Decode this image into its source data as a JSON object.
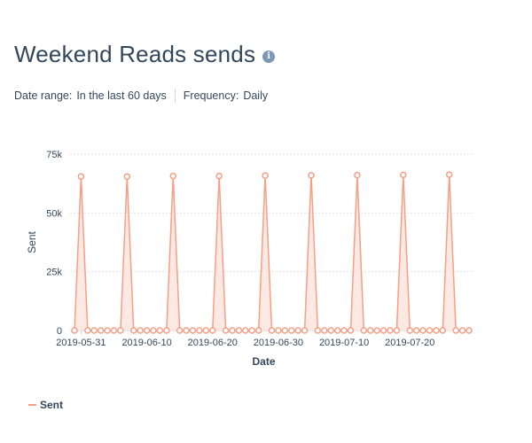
{
  "header": {
    "title": "Weekend Reads sends",
    "info_icon": "info-icon"
  },
  "filters": {
    "date_range_label": "Date range:",
    "date_range_value": "In the last 60 days",
    "frequency_label": "Frequency:",
    "frequency_value": "Daily"
  },
  "colors": {
    "series": "#f59f85",
    "series_fill": "#fde4dc",
    "grid": "#dfe3eb",
    "text": "#33475b"
  },
  "chart_data": {
    "type": "area",
    "title": "",
    "xlabel": "Date",
    "ylabel": "Sent",
    "ylim": [
      0,
      75000
    ],
    "y_ticks": [
      0,
      25000,
      50000,
      75000
    ],
    "y_tick_labels": [
      "0",
      "25k",
      "50k",
      "75k"
    ],
    "x_start": "2019-05-30",
    "x_end": "2019-07-29",
    "x_ticks": [
      "2019-05-31",
      "2019-06-10",
      "2019-06-20",
      "2019-06-30",
      "2019-07-10",
      "2019-07-20"
    ],
    "grid": true,
    "legend": "bottom-left",
    "series": [
      {
        "name": "Sent",
        "points": [
          [
            "2019-05-30",
            0
          ],
          [
            "2019-05-31",
            65500
          ],
          [
            "2019-06-01",
            0
          ],
          [
            "2019-06-02",
            0
          ],
          [
            "2019-06-03",
            0
          ],
          [
            "2019-06-04",
            0
          ],
          [
            "2019-06-05",
            0
          ],
          [
            "2019-06-06",
            0
          ],
          [
            "2019-06-07",
            65500
          ],
          [
            "2019-06-08",
            0
          ],
          [
            "2019-06-09",
            0
          ],
          [
            "2019-06-10",
            0
          ],
          [
            "2019-06-11",
            0
          ],
          [
            "2019-06-12",
            0
          ],
          [
            "2019-06-13",
            0
          ],
          [
            "2019-06-14",
            65700
          ],
          [
            "2019-06-15",
            0
          ],
          [
            "2019-06-16",
            0
          ],
          [
            "2019-06-17",
            0
          ],
          [
            "2019-06-18",
            0
          ],
          [
            "2019-06-19",
            0
          ],
          [
            "2019-06-20",
            0
          ],
          [
            "2019-06-21",
            65700
          ],
          [
            "2019-06-22",
            0
          ],
          [
            "2019-06-23",
            0
          ],
          [
            "2019-06-24",
            0
          ],
          [
            "2019-06-25",
            0
          ],
          [
            "2019-06-26",
            0
          ],
          [
            "2019-06-27",
            0
          ],
          [
            "2019-06-28",
            65900
          ],
          [
            "2019-06-29",
            0
          ],
          [
            "2019-06-30",
            0
          ],
          [
            "2019-07-01",
            0
          ],
          [
            "2019-07-02",
            0
          ],
          [
            "2019-07-03",
            0
          ],
          [
            "2019-07-04",
            0
          ],
          [
            "2019-07-05",
            66000
          ],
          [
            "2019-07-06",
            0
          ],
          [
            "2019-07-07",
            0
          ],
          [
            "2019-07-08",
            0
          ],
          [
            "2019-07-09",
            0
          ],
          [
            "2019-07-10",
            0
          ],
          [
            "2019-07-11",
            0
          ],
          [
            "2019-07-12",
            66100
          ],
          [
            "2019-07-13",
            0
          ],
          [
            "2019-07-14",
            0
          ],
          [
            "2019-07-15",
            0
          ],
          [
            "2019-07-16",
            0
          ],
          [
            "2019-07-17",
            0
          ],
          [
            "2019-07-18",
            0
          ],
          [
            "2019-07-19",
            66200
          ],
          [
            "2019-07-20",
            0
          ],
          [
            "2019-07-21",
            0
          ],
          [
            "2019-07-22",
            0
          ],
          [
            "2019-07-23",
            0
          ],
          [
            "2019-07-24",
            0
          ],
          [
            "2019-07-25",
            0
          ],
          [
            "2019-07-26",
            66300
          ],
          [
            "2019-07-27",
            0
          ],
          [
            "2019-07-28",
            0
          ],
          [
            "2019-07-29",
            0
          ]
        ]
      }
    ]
  }
}
